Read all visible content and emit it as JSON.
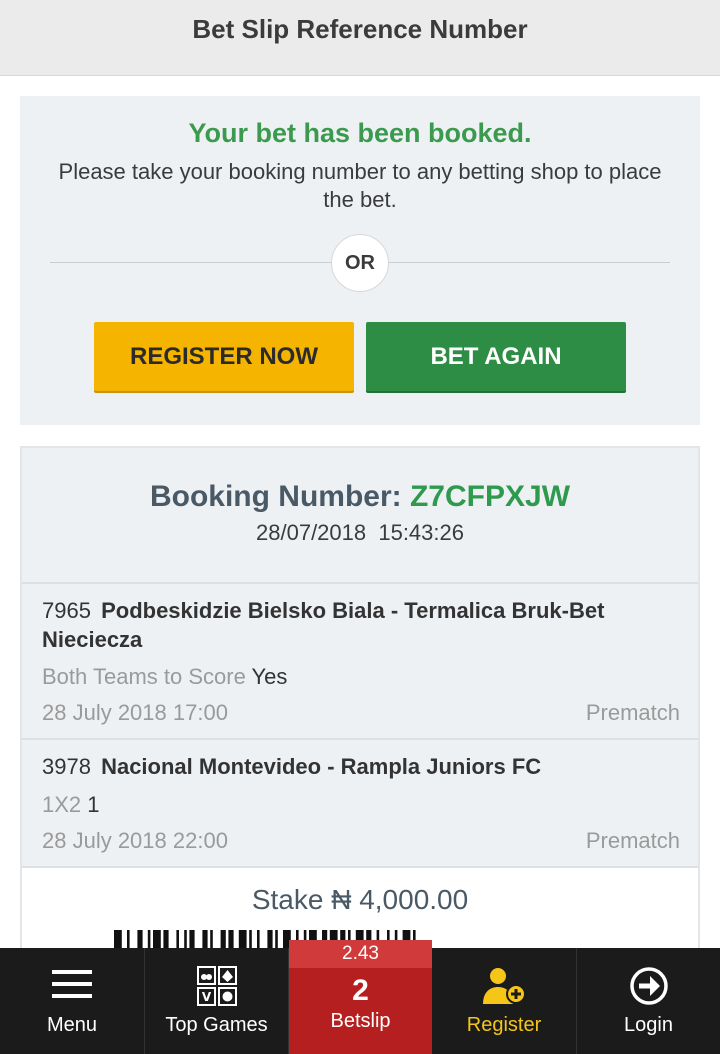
{
  "header": {
    "title": "Bet Slip Reference Number"
  },
  "booked": {
    "title": "Your bet has been booked.",
    "message": "Please take your booking number to any betting shop to place the bet.",
    "or_label": "OR",
    "register_button": "REGISTER NOW",
    "bet_again_button": "BET AGAIN"
  },
  "booking": {
    "label": "Booking Number:",
    "code": "Z7CFPXJW",
    "datetime": "28/07/2018  15:43:26"
  },
  "selections": [
    {
      "event_id": "7965",
      "teams": "Podbeskidzie Bielsko Biala - Termalica Bruk-Bet Nieciecza",
      "market": "Both Teams to Score",
      "pick": "Yes",
      "time": "28 July 2018 17:00",
      "type": "Prematch"
    },
    {
      "event_id": "3978",
      "teams": "Nacional Montevideo - Rampla Juniors FC",
      "market": "1X2",
      "pick": "1",
      "time": "28 July 2018 22:00",
      "type": "Prematch"
    }
  ],
  "stake": {
    "text": "Stake ₦ 4,000.00"
  },
  "nav": {
    "menu": "Menu",
    "top_games": "Top Games",
    "betslip_odds": "2.43",
    "betslip_count": "2",
    "betslip": "Betslip",
    "register": "Register",
    "login": "Login"
  },
  "colors": {
    "green": "#2e8d45",
    "yellow": "#f5b400",
    "betslip_red": "#b51f1f",
    "nav_bg": "#1b1b1b"
  },
  "icons": [
    "menu-icon",
    "top-games-icon",
    "register-user-icon",
    "login-icon"
  ]
}
